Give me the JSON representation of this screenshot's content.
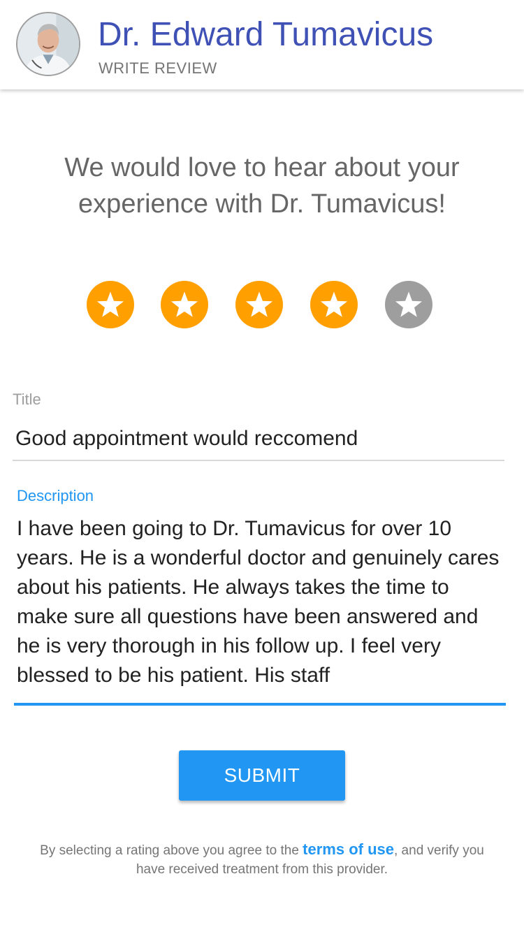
{
  "header": {
    "doctor_name": "Dr. Edward Tumavicus",
    "subtitle": "WRITE REVIEW"
  },
  "prompt": "We would love to hear about your experience with Dr. Tumavicus!",
  "rating": {
    "value": 4,
    "max": 5,
    "active_color": "#ff9f00",
    "inactive_color": "#9e9e9e"
  },
  "form": {
    "title_label": "Title",
    "title_value": "Good appointment would reccomend",
    "description_label": "Description",
    "description_value": "I have been going to Dr. Tumavicus for over 10 years. He is a wonderful doctor and genuinely cares about his patients. He always takes the time to make sure all questions have been answered and he is very thorough in his follow up. I feel very blessed to be his patient. His staff"
  },
  "submit_label": "SUBMIT",
  "disclaimer": {
    "before": "By selecting a rating above you agree to the ",
    "link": "terms of use",
    "after": ", and verify you have received treatment from this provider."
  },
  "colors": {
    "title_text": "#3f51b5",
    "accent": "#2196f3"
  }
}
